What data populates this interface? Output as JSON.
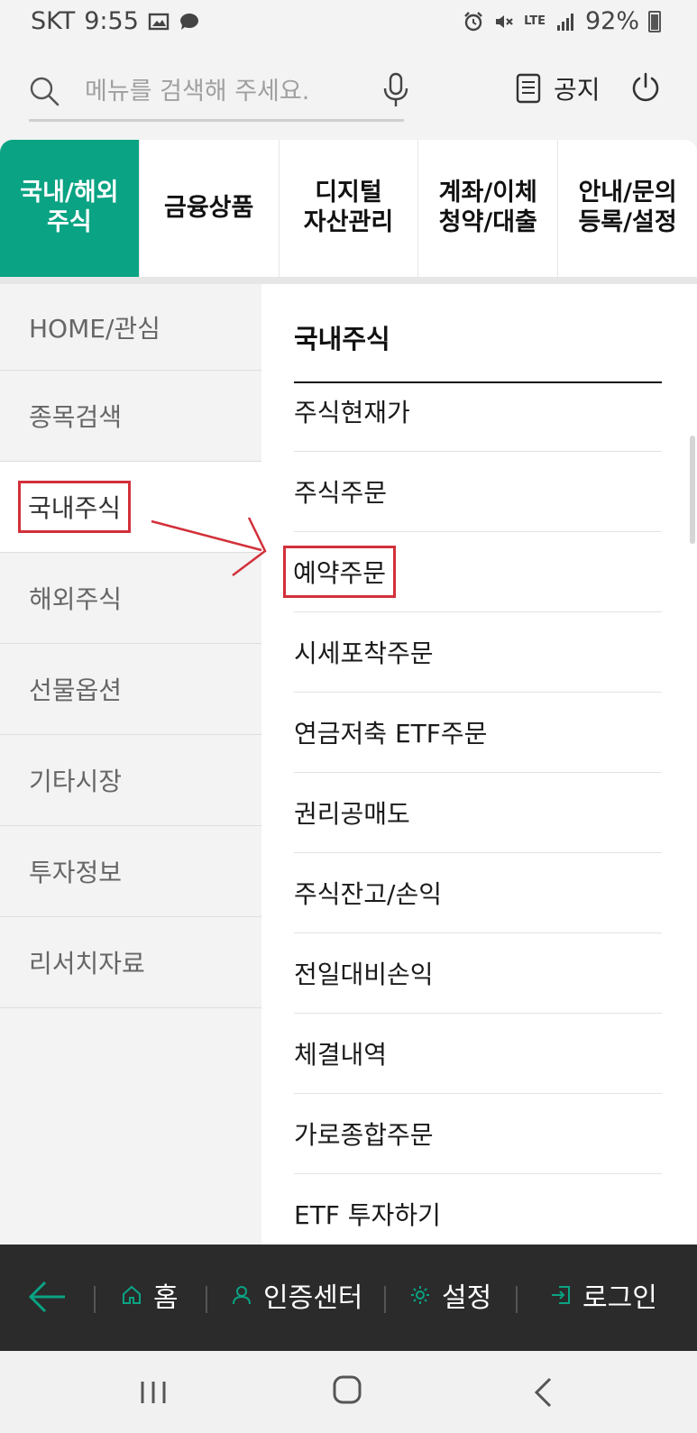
{
  "status_bar": {
    "carrier": "SKT",
    "time": "9:55",
    "network": "LTE",
    "battery": "92%"
  },
  "search": {
    "placeholder": "메뉴를 검색해 주세요.",
    "value": ""
  },
  "header": {
    "notice_label": "공지"
  },
  "tabs": [
    {
      "label": "국내/해외\n주식",
      "active": true
    },
    {
      "label": "금융상품",
      "active": false
    },
    {
      "label": "디지털\n자산관리",
      "active": false
    },
    {
      "label": "계좌/이체\n청약/대출",
      "active": false
    },
    {
      "label": "안내/문의\n등록/설정",
      "active": false
    }
  ],
  "left_menu": {
    "items": [
      {
        "label": "HOME/관심"
      },
      {
        "label": "종목검색"
      },
      {
        "label": "국내주식"
      },
      {
        "label": "해외주식"
      },
      {
        "label": "선물옵션"
      },
      {
        "label": "기타시장"
      },
      {
        "label": "투자정보"
      },
      {
        "label": "리서치자료"
      }
    ],
    "active_index": 2
  },
  "submenu": {
    "title": "국내주식",
    "items": [
      {
        "label": "주식현재가"
      },
      {
        "label": "주식주문"
      },
      {
        "label": "예약주문"
      },
      {
        "label": "시세포착주문"
      },
      {
        "label": "연금저축 ETF주문"
      },
      {
        "label": "권리공매도"
      },
      {
        "label": "주식잔고/손익"
      },
      {
        "label": "전일대비손익"
      },
      {
        "label": "체결내역"
      },
      {
        "label": "가로종합주문"
      },
      {
        "label": "ETF 투자하기"
      }
    ],
    "highlighted_index": 2
  },
  "bottom_nav": {
    "home": "홈",
    "auth_center": "인증센터",
    "settings": "설정",
    "login": "로그인"
  },
  "colors": {
    "accent": "#0aa383",
    "highlight": "#d2303a",
    "bottom_bar": "#2b2b2b"
  }
}
